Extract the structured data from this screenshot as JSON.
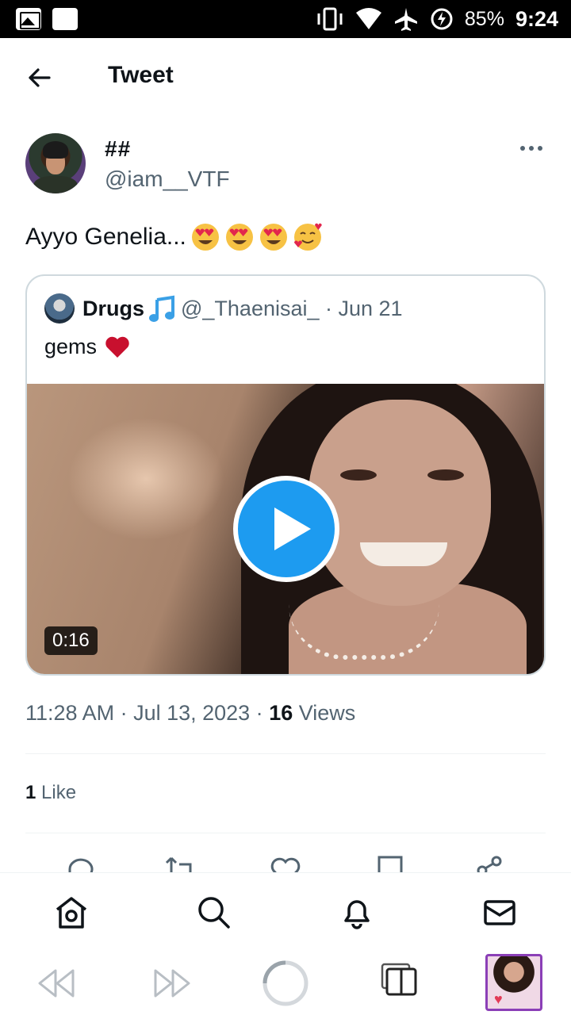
{
  "status_bar": {
    "battery": "85%",
    "time": "9:24"
  },
  "header": {
    "title": "Tweet"
  },
  "tweet": {
    "author_name": "##",
    "author_handle": "@iam__VTF",
    "text": "Ayyo Genelia...",
    "emojis": [
      "heart-eyes",
      "heart-eyes",
      "heart-eyes",
      "smiling-face-with-hearts"
    ],
    "timestamp": "11:28 AM · Jul 13, 2023 · ",
    "views_count": "16",
    "views_label": " Views",
    "likes_count": "1",
    "likes_label": " Like"
  },
  "quote": {
    "name": "Drugs",
    "handle_date": "@_Thaenisai_ · Jun 21",
    "text": "gems",
    "video_duration": "0:16"
  },
  "colors": {
    "accent": "#1d9bf0",
    "secondary_text": "#536471",
    "border": "#cfd9de",
    "like_heart": "#c8102e"
  },
  "icons": {
    "back": "arrow-left-icon",
    "more": "more-horizontal-icon",
    "nav": [
      "home-icon",
      "search-icon",
      "bell-icon",
      "mail-icon"
    ],
    "actions": [
      "reply-icon",
      "retweet-icon",
      "like-icon",
      "bookmark-icon",
      "share-icon"
    ],
    "toolbar": [
      "rewind-icon",
      "fast-forward-icon",
      "reload-icon",
      "tabs-icon"
    ]
  }
}
